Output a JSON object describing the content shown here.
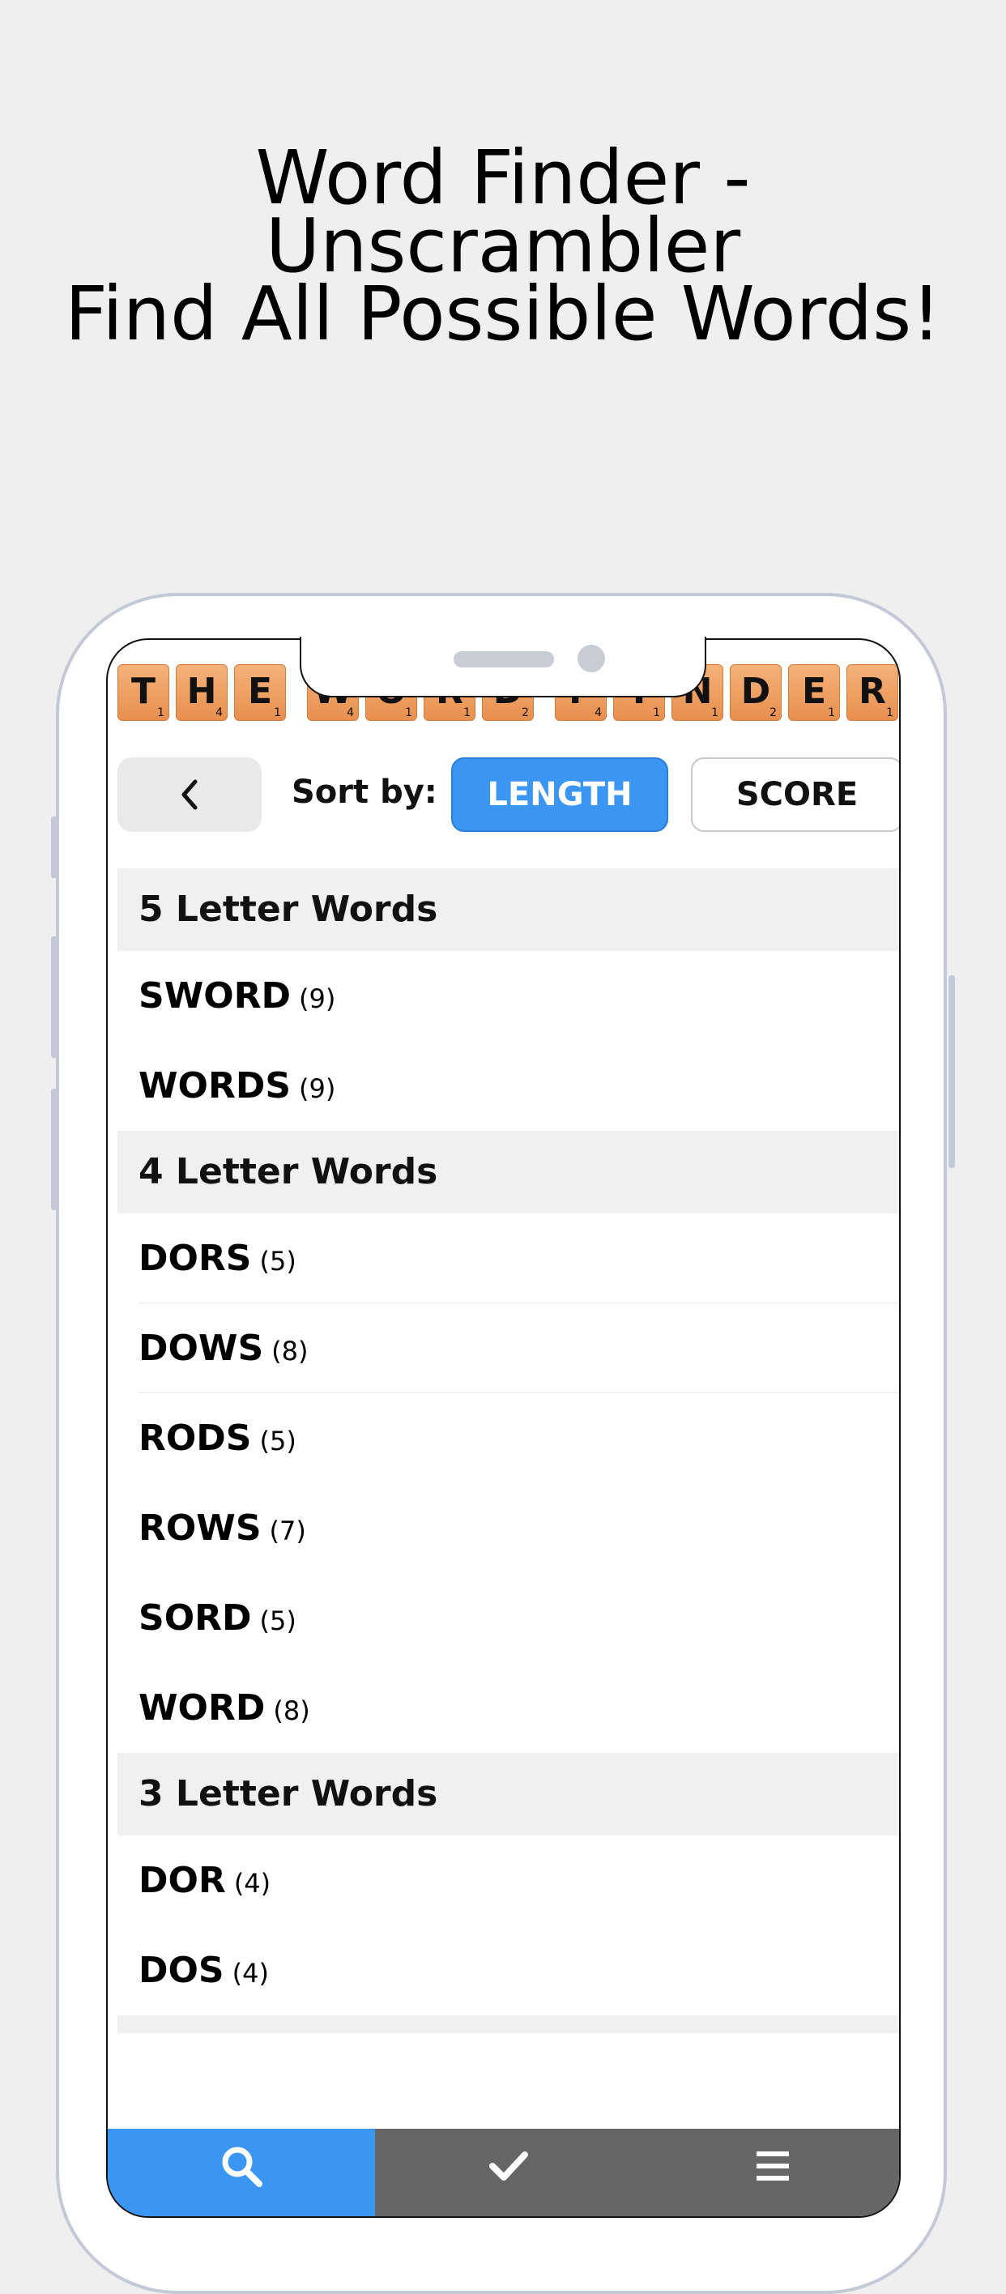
{
  "promo": {
    "line1": "Word Finder -",
    "line2": "Unscrambler",
    "line3": "Find All Possible Words!"
  },
  "logo": {
    "tiles": [
      {
        "letter": "T",
        "points": "1"
      },
      {
        "letter": "H",
        "points": "4"
      },
      {
        "letter": "E",
        "points": "1"
      },
      {
        "letter": "W",
        "points": "4"
      },
      {
        "letter": "O",
        "points": "1"
      },
      {
        "letter": "R",
        "points": "1"
      },
      {
        "letter": "D",
        "points": "2"
      },
      {
        "letter": "F",
        "points": "4"
      },
      {
        "letter": "I",
        "points": "1"
      },
      {
        "letter": "N",
        "points": "1"
      },
      {
        "letter": "D",
        "points": "2"
      },
      {
        "letter": "E",
        "points": "1"
      },
      {
        "letter": "R",
        "points": "1"
      }
    ]
  },
  "sortbar": {
    "back_icon": "chevron-left-icon",
    "label": "Sort by:",
    "options": [
      "LENGTH",
      "SCORE"
    ],
    "selected": "LENGTH"
  },
  "sections": [
    {
      "title": "5 Letter Words",
      "words": [
        {
          "word": "SWORD",
          "score": "(9)"
        },
        {
          "word": "WORDS",
          "score": "(9)"
        }
      ]
    },
    {
      "title": "4 Letter Words",
      "words": [
        {
          "word": "DORS",
          "score": "(5)"
        },
        {
          "word": "DOWS",
          "score": "(8)"
        },
        {
          "word": "RODS",
          "score": "(5)"
        },
        {
          "word": "ROWS",
          "score": "(7)"
        },
        {
          "word": "SORD",
          "score": "(5)"
        },
        {
          "word": "WORD",
          "score": "(8)"
        }
      ]
    },
    {
      "title": "3 Letter Words",
      "words": [
        {
          "word": "DOR",
          "score": "(4)"
        },
        {
          "word": "DOS",
          "score": "(4)"
        }
      ]
    }
  ],
  "tabbar": {
    "tabs": [
      {
        "icon": "search-icon",
        "active": true
      },
      {
        "icon": "checkmark-icon",
        "active": false
      },
      {
        "icon": "menu-icon",
        "active": false
      }
    ]
  },
  "colors": {
    "accent": "#3a95f3",
    "tile": "#eb9a5c",
    "tab_inactive": "#666666",
    "background": "#efefef"
  }
}
